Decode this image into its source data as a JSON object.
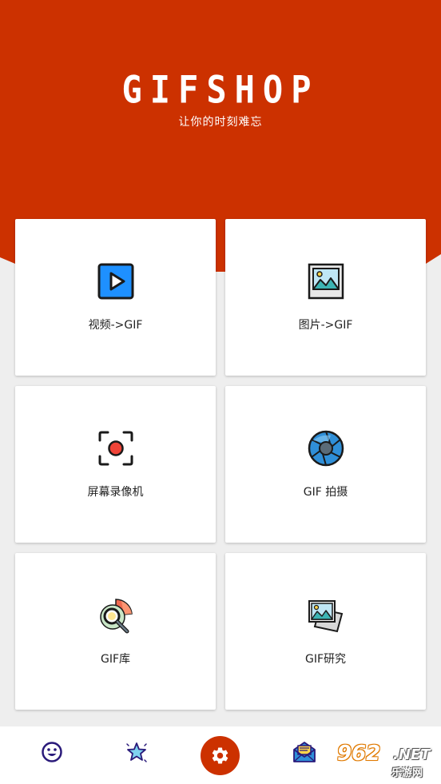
{
  "header": {
    "title": "GIFSHOP",
    "subtitle": "让你的时刻难忘"
  },
  "cards": [
    {
      "label": "视频->GIF",
      "icon": "video-play-icon"
    },
    {
      "label": "图片->GIF",
      "icon": "picture-icon"
    },
    {
      "label": "屏幕录像机",
      "icon": "screen-record-icon"
    },
    {
      "label": "GIF 拍摄",
      "icon": "camera-aperture-icon"
    },
    {
      "label": "GIF库",
      "icon": "library-search-icon"
    },
    {
      "label": "GIF研究",
      "icon": "photos-stack-icon"
    }
  ],
  "bottom_nav": [
    {
      "icon": "smiley-icon"
    },
    {
      "icon": "sparkle-star-icon"
    },
    {
      "icon": "gear-icon",
      "active": true
    },
    {
      "icon": "mail-icon"
    }
  ],
  "watermark": {
    "number": "962",
    "suffix": ".NET",
    "text": "乐游网"
  },
  "colors": {
    "brand": "#cc3100",
    "background": "#eeeeee",
    "card": "#ffffff"
  }
}
